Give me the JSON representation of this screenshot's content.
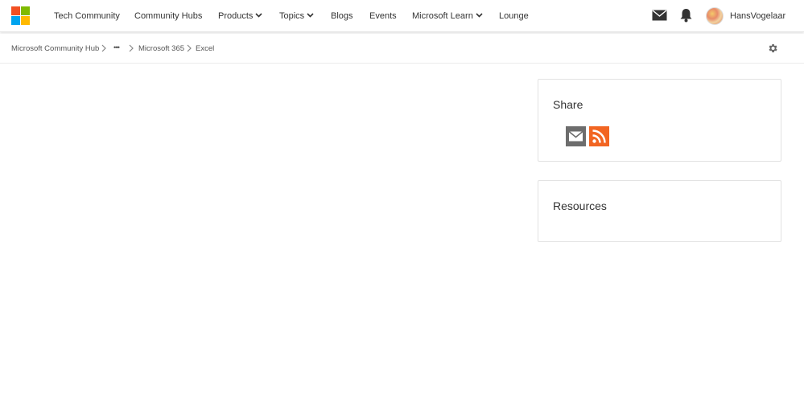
{
  "nav": {
    "tech_community": "Tech Community",
    "community_hubs": "Community Hubs",
    "products": "Products",
    "topics": "Topics",
    "blogs": "Blogs",
    "events": "Events",
    "microsoft_learn": "Microsoft Learn",
    "lounge": "Lounge",
    "username": "HansVogelaar"
  },
  "breadcrumb": {
    "hub": "Microsoft Community Hub",
    "ellipsis": "•••",
    "m365": "Microsoft 365",
    "excel": "Excel"
  },
  "share": {
    "title": "Share"
  },
  "resources": {
    "title": "Resources"
  },
  "colors": {
    "logo_red": "#f25022",
    "logo_green": "#7fba00",
    "logo_blue": "#00a4ef",
    "logo_yellow": "#ffb900",
    "rss_orange": "#f26522",
    "email_gray": "#6d6d6d"
  },
  "icons": [
    "microsoft-logo",
    "mail-icon",
    "bell-icon",
    "avatar",
    "chevron-right-icon",
    "gear-icon",
    "email-share-icon",
    "rss-icon"
  ]
}
